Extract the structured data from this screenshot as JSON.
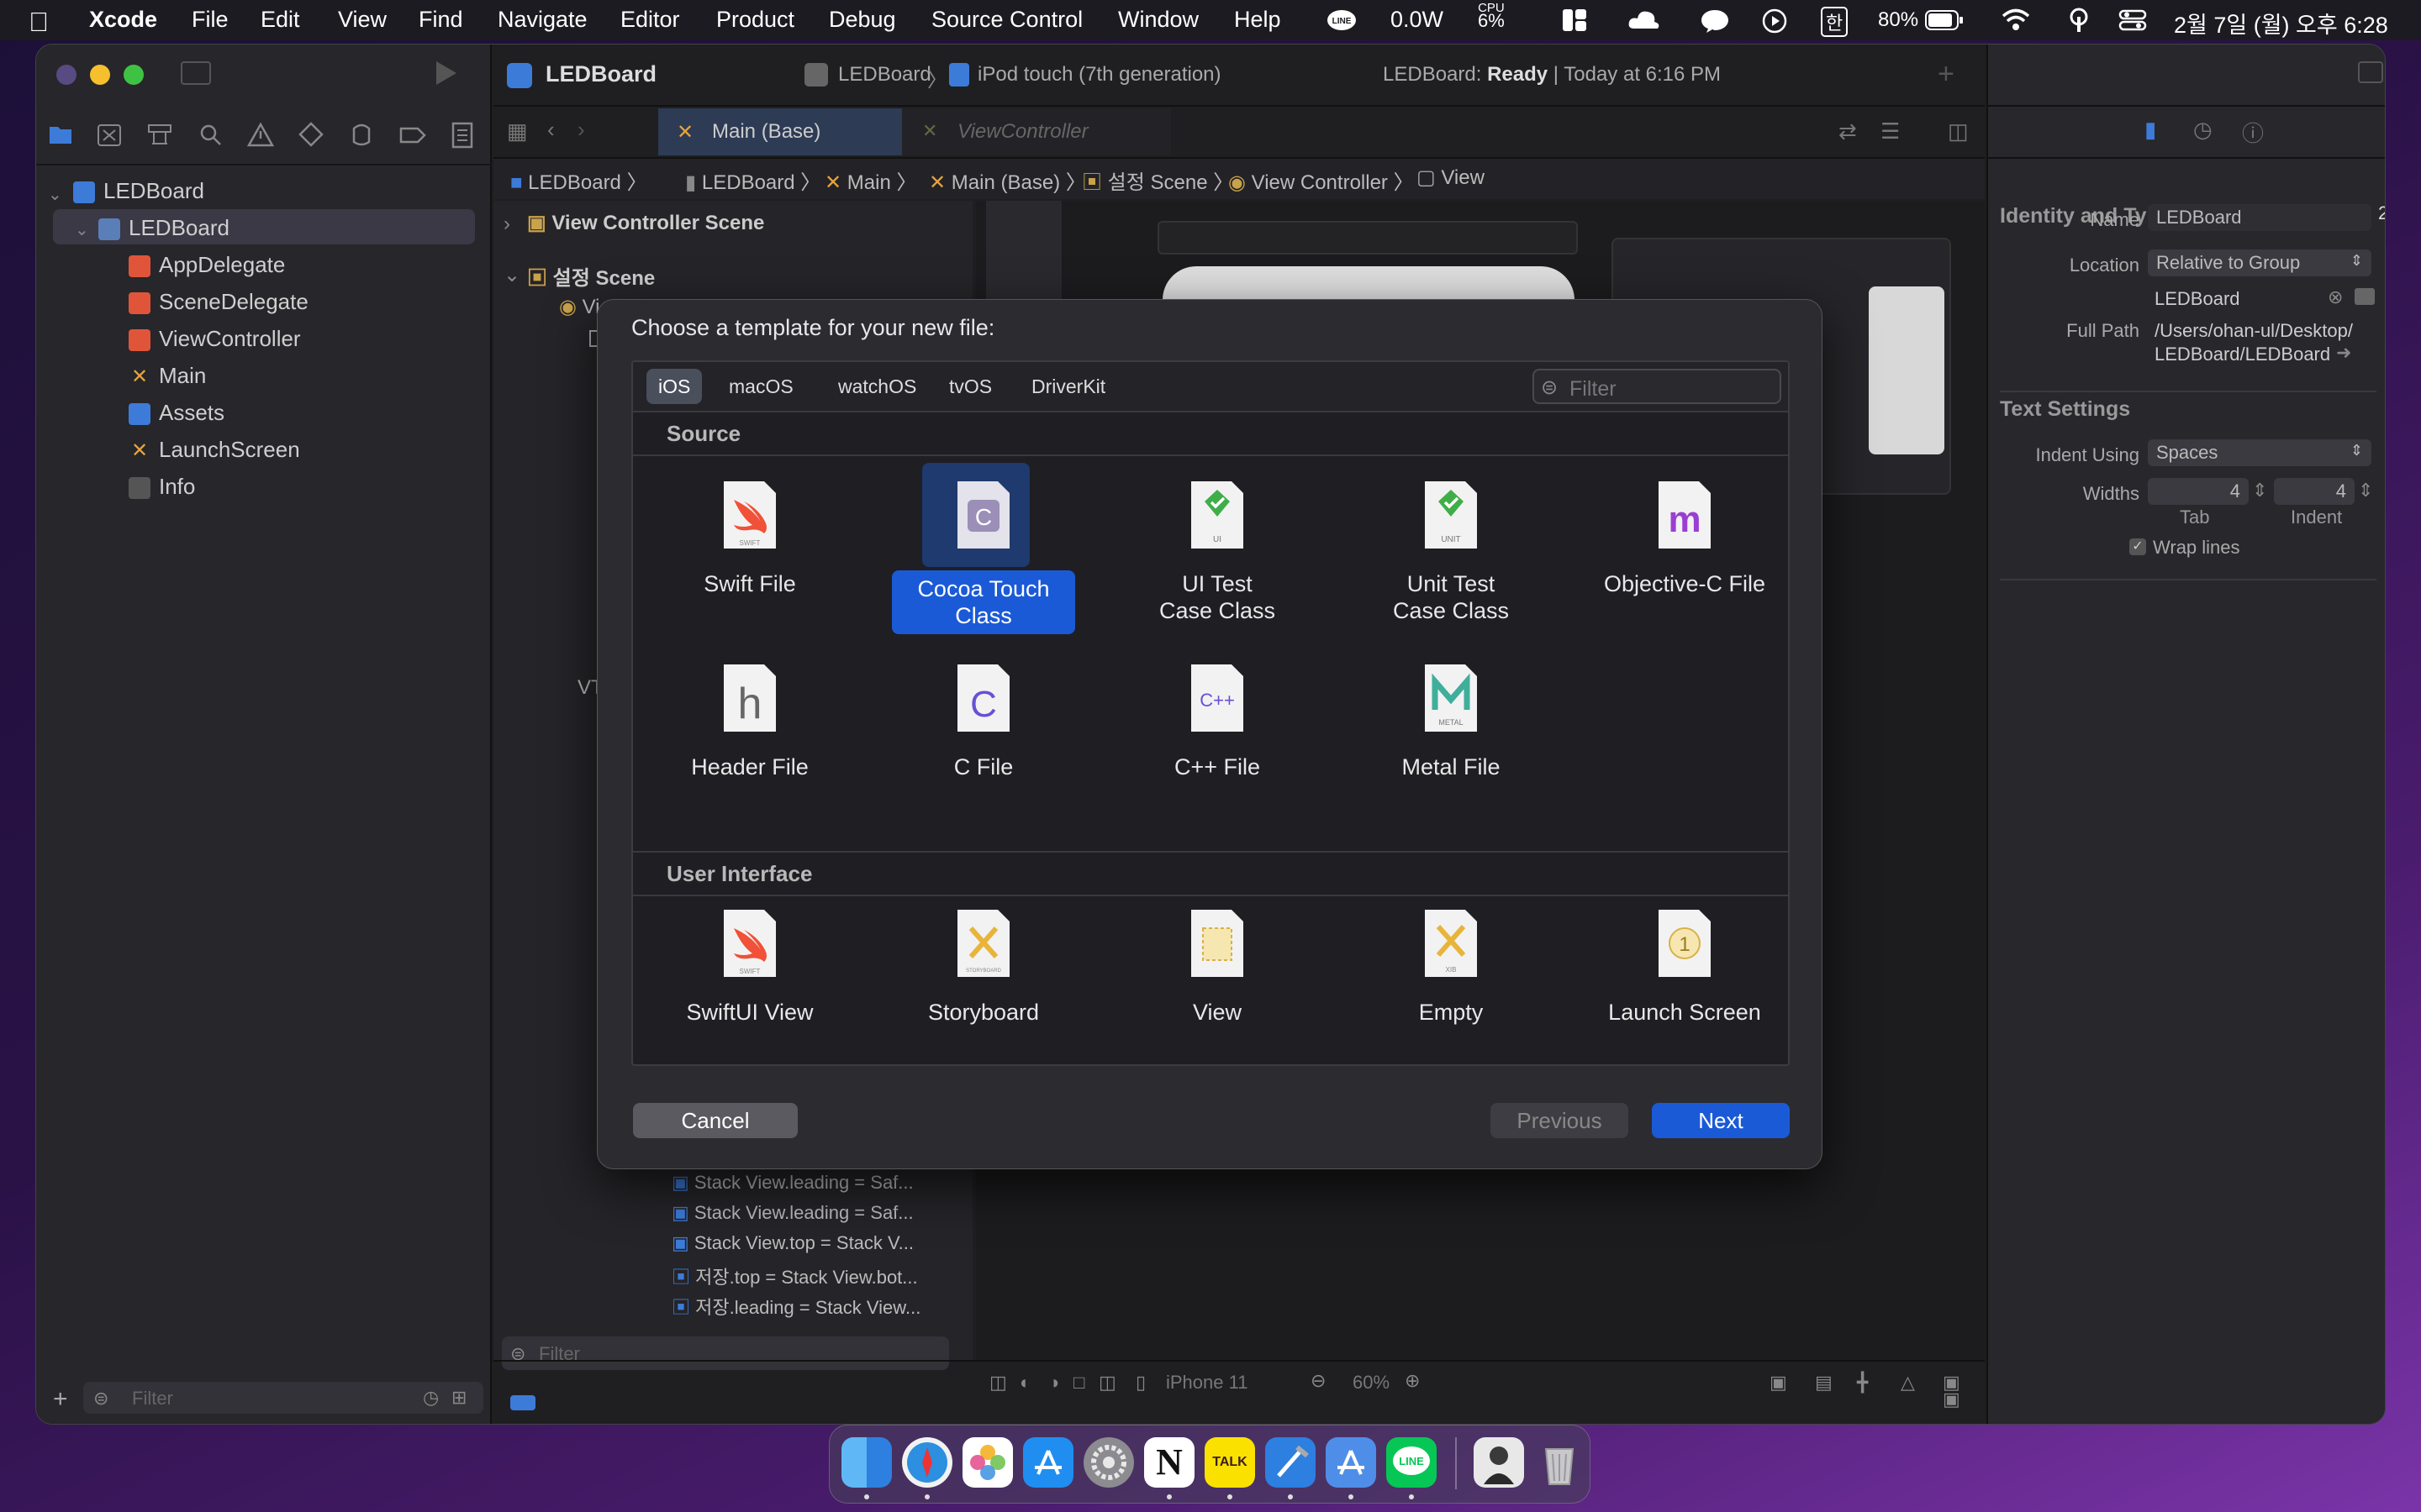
{
  "menubar": {
    "app_name": "Xcode",
    "menus": [
      "File",
      "Edit",
      "View",
      "Find",
      "Navigate",
      "Editor",
      "Product",
      "Debug",
      "Source Control",
      "Window",
      "Help"
    ],
    "status": {
      "power": "0.0W",
      "cpu_label": "CPU",
      "cpu_value": "6%",
      "battery": "80%",
      "hangul": "한",
      "datetime": "2월 7일 (월) 오후 6:28"
    }
  },
  "window": {
    "project_title": "LEDBoard",
    "scheme": "LEDBoard",
    "device": "iPod touch (7th generation)",
    "status_name": "LEDBoard:",
    "status_state": "Ready",
    "status_time": "| Today at 6:16 PM"
  },
  "navigator": {
    "root": "LEDBoard",
    "group": "LEDBoard",
    "files": [
      "AppDelegate",
      "SceneDelegate",
      "ViewController",
      "Main",
      "Assets",
      "LaunchScreen",
      "Info"
    ],
    "filter_placeholder": "Filter"
  },
  "editor": {
    "tab_active": "Main (Base)",
    "tab_inactive": "ViewController",
    "breadcrumb": [
      "LEDBoard",
      "LEDBoard",
      "Main",
      "Main (Base)",
      "설정 Scene",
      "View Controller",
      "View"
    ],
    "outline": {
      "scene1": "View Controller Scene",
      "scene2": "설정 Scene",
      "trunc_item": "Vi",
      "trunc_item2": "VTl",
      "constraints": [
        "Stack View.leading = Saf...",
        "Stack View.leading = Saf...",
        "Stack View.top = Stack V...",
        "저장.top = Stack View.bot...",
        "저장.leading = Stack View..."
      ]
    },
    "outline_filter": "Filter",
    "device_label": "iPhone 11",
    "zoom": "60%"
  },
  "inspector": {
    "identity_heading": "Identity and Type",
    "name_label": "Name",
    "name_value": "LEDBoard",
    "location_label": "Location",
    "location_value": "Relative to Group",
    "location_path": "LEDBoard",
    "fullpath_label": "Full Path",
    "fullpath_line1": "/Users/ohan-ul/Desktop/",
    "fullpath_line2": "LEDBoard/LEDBoard",
    "text_heading": "Text Settings",
    "indent_label": "Indent Using",
    "indent_value": "Spaces",
    "widths_label": "Widths",
    "tab_value": "4",
    "indent_width_value": "4",
    "tab_caption": "Tab",
    "indent_caption": "Indent",
    "wrap_label": "Wrap lines",
    "edge_digit": "2"
  },
  "dialog": {
    "title": "Choose a template for your new file:",
    "platforms": [
      "iOS",
      "macOS",
      "watchOS",
      "tvOS",
      "DriverKit"
    ],
    "filter_placeholder": "Filter",
    "section_source": "Source",
    "section_ui": "User Interface",
    "source_row1": [
      "Swift File",
      "Cocoa Touch\nClass",
      "UI Test\nCase Class",
      "Unit Test\nCase Class",
      "Objective-C File"
    ],
    "source_row2": [
      "Header File",
      "C File",
      "C++ File",
      "Metal File"
    ],
    "ui_row": [
      "SwiftUI View",
      "Storyboard",
      "View",
      "Empty",
      "Launch Screen"
    ],
    "icon_text": {
      "swift": "SWIFT",
      "c": "C",
      "ui": "UI",
      "unit": "UNIT",
      "m": "m",
      "h": "h",
      "cpp": "C++",
      "metal": "METAL",
      "storyboard": "STORYBOARD",
      "xib": "XIB",
      "launch": "1"
    },
    "cancel": "Cancel",
    "previous": "Previous",
    "next": "Next"
  },
  "dock": {
    "apps": [
      "finder-icon",
      "safari-icon",
      "photos-icon",
      "app-store-icon",
      "system-preferences-icon",
      "notion-icon",
      "kakaotalk-icon",
      "xcode-icon",
      "simulator-icon",
      "line-icon",
      "profile-photo-icon",
      "trash-icon"
    ],
    "kakaotalk_label": "TALK",
    "notion_label": "N"
  }
}
